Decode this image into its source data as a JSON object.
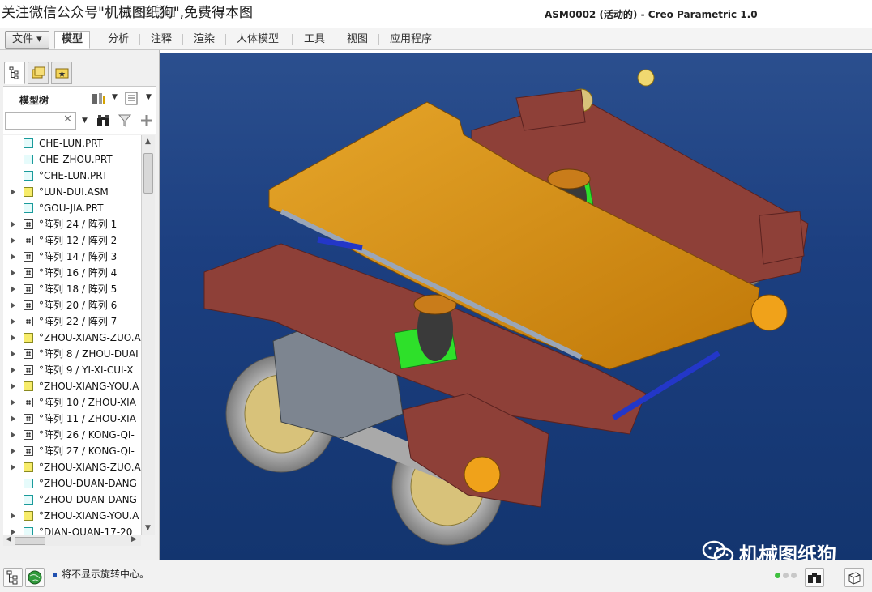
{
  "window": {
    "watermark_top": "关注微信公众号\"机械图纸狗\",免费得本图",
    "title": "ASM0002 (活动的) - Creo Parametric 1.0"
  },
  "ribbon": {
    "tabs": [
      {
        "label": "文件 ▾"
      },
      {
        "label": "模型"
      },
      {
        "label": "分析"
      },
      {
        "label": "注释"
      },
      {
        "label": "渲染"
      },
      {
        "label": "人体模型"
      },
      {
        "label": "工具"
      },
      {
        "label": "视图"
      },
      {
        "label": "应用程序"
      }
    ],
    "active_tab": "模型"
  },
  "model_tree": {
    "title": "模型树",
    "search_value": "",
    "items": [
      {
        "label": "CHE-LUN.PRT",
        "type": "part",
        "expandable": false
      },
      {
        "label": "CHE-ZHOU.PRT",
        "type": "part",
        "expandable": false
      },
      {
        "label": "°CHE-LUN.PRT",
        "type": "part",
        "expandable": false
      },
      {
        "label": "°LUN-DUI.ASM",
        "type": "asm",
        "expandable": true
      },
      {
        "label": "°GOU-JIA.PRT",
        "type": "part",
        "expandable": false
      },
      {
        "label": "°阵列 24 / 阵列 1",
        "type": "pattern",
        "expandable": true
      },
      {
        "label": "°阵列 12 / 阵列 2",
        "type": "pattern",
        "expandable": true
      },
      {
        "label": "°阵列 14 / 阵列 3",
        "type": "pattern",
        "expandable": true
      },
      {
        "label": "°阵列 16 / 阵列 4",
        "type": "pattern",
        "expandable": true
      },
      {
        "label": "°阵列 18 / 阵列 5",
        "type": "pattern",
        "expandable": true
      },
      {
        "label": "°阵列 20 / 阵列 6",
        "type": "pattern",
        "expandable": true
      },
      {
        "label": "°阵列 22 / 阵列 7",
        "type": "pattern",
        "expandable": true
      },
      {
        "label": "°ZHOU-XIANG-ZUO.A",
        "type": "asm",
        "expandable": true
      },
      {
        "label": "°阵列 8 / ZHOU-DUAI",
        "type": "pattern",
        "expandable": true
      },
      {
        "label": "°阵列 9 / YI-XI-CUI-X",
        "type": "pattern",
        "expandable": true
      },
      {
        "label": "°ZHOU-XIANG-YOU.A",
        "type": "asm",
        "expandable": true
      },
      {
        "label": "°阵列 10 / ZHOU-XIA",
        "type": "pattern",
        "expandable": true
      },
      {
        "label": "°阵列 11 / ZHOU-XIA",
        "type": "pattern",
        "expandable": true
      },
      {
        "label": "°阵列 26 / KONG-QI-",
        "type": "pattern",
        "expandable": true
      },
      {
        "label": "°阵列 27 / KONG-QI-",
        "type": "pattern",
        "expandable": true
      },
      {
        "label": "°ZHOU-XIANG-ZUO.A",
        "type": "asm",
        "expandable": true
      },
      {
        "label": "°ZHOU-DUAN-DANG",
        "type": "part",
        "expandable": false
      },
      {
        "label": "°ZHOU-DUAN-DANG",
        "type": "part",
        "expandable": false
      },
      {
        "label": "°ZHOU-XIANG-YOU.A",
        "type": "asm",
        "expandable": true
      },
      {
        "label": "°DIAN-QUAN-17-20",
        "type": "part",
        "expandable": true
      }
    ]
  },
  "status": {
    "message": "将不显示旋转中心。"
  },
  "watermark_br": "机械图纸狗",
  "colors": {
    "viewport_top": "#2b4f8e",
    "viewport_bottom": "#13356f",
    "frame_orange": "#d9930f",
    "bogie_red": "#8e4038",
    "green_plate": "#2ee02a",
    "wheel_grey": "#b0b0b0",
    "gearbox_grey": "#7d8590"
  }
}
